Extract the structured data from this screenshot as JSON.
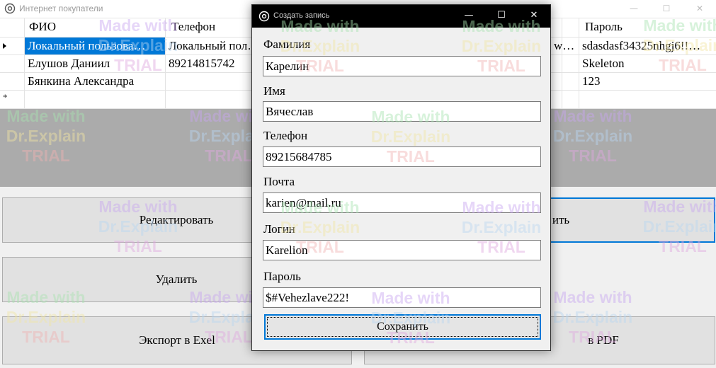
{
  "main_window": {
    "title": "Интернет покупатели",
    "icon": "app-gear-icon",
    "controls": {
      "minimize": "—",
      "maximize": "☐",
      "close": "✕"
    }
  },
  "grid": {
    "columns": [
      "ФИО",
      "Телефон",
      "",
      "Пароль"
    ],
    "rows": [
      {
        "fio": "Локальный пользова…",
        "phone": "Локальный пол…",
        "mid": "w…",
        "password": "sdasdasf34325nhgj6!!…",
        "selected": true
      },
      {
        "fio": "Елушов Даниил",
        "phone": "89214815742",
        "mid": "",
        "password": "Skeleton",
        "selected": false
      },
      {
        "fio": "Бянкина Александра",
        "phone": "",
        "mid": "",
        "password": "123",
        "selected": false
      }
    ],
    "new_row_marker": "*",
    "selection_color": "#0078d7"
  },
  "buttons": {
    "edit": "Редактировать",
    "add_partial": "ить",
    "delete": "Удалить",
    "export_excel": "Экспорт в Exel",
    "export_pdf_partial": "в PDF"
  },
  "dialog": {
    "title": "Создать запись",
    "controls": {
      "minimize": "—",
      "maximize": "☐",
      "close": "✕"
    },
    "fields": {
      "last_name": {
        "label": "Фамилия",
        "value": "Карелин"
      },
      "first_name": {
        "label": "Имя",
        "value": "Вячеслав"
      },
      "phone": {
        "label": "Телефон",
        "value": "89215684785"
      },
      "email": {
        "label": "Почта",
        "value": "karien@mail.ru"
      },
      "login": {
        "label": "Логин",
        "value": "Karelion"
      },
      "password": {
        "label": "Пароль",
        "value": "$#Vehezlave222!"
      }
    },
    "save_label": "Сохранить",
    "accent": "#0078d7"
  },
  "watermark": {
    "line1": "Made with",
    "line2": "Dr.Explain",
    "line3": "TRIAL"
  }
}
